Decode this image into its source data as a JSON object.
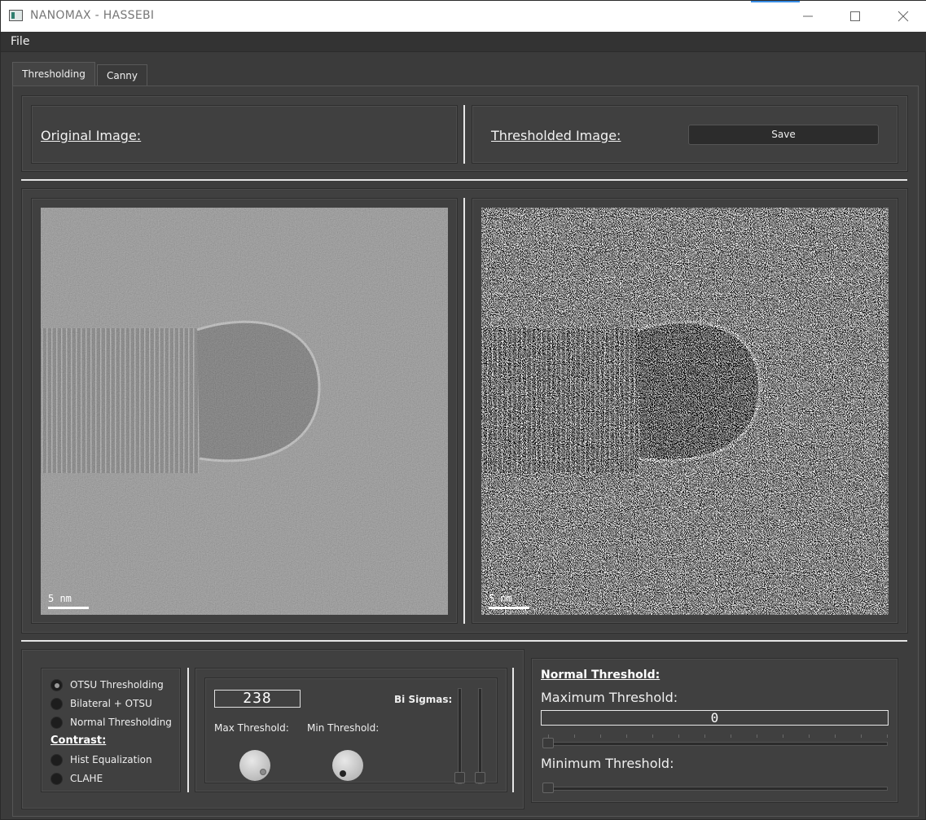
{
  "window": {
    "title": "NANOMAX - HASSEBI",
    "min_icon": "minimize-icon",
    "max_icon": "maximize-icon",
    "close_icon": "close-icon"
  },
  "menu": {
    "file": "File"
  },
  "tabs": [
    {
      "label": "Thresholding",
      "active": true
    },
    {
      "label": "Canny",
      "active": false
    }
  ],
  "header": {
    "original_label": "Original Image:",
    "thresholded_label": "Thresholded Image:",
    "save_label": "Save"
  },
  "images": {
    "scale_text": "5 nm"
  },
  "methods": {
    "options": [
      {
        "label": "OTSU Thresholding",
        "checked": true
      },
      {
        "label": "Bilateral + OTSU",
        "checked": false
      },
      {
        "label": "Normal Thresholding",
        "checked": false
      }
    ],
    "contrast_label": "Contrast:",
    "contrast_options": [
      {
        "label": "Hist Equalization",
        "checked": false
      },
      {
        "label": "CLAHE",
        "checked": false
      }
    ]
  },
  "dials": {
    "lcd_value": "238",
    "max_label": "Max Threshold:",
    "min_label": "Min Threshold:",
    "bi_sigmas_label": "Bi Sigmas:"
  },
  "normal_threshold": {
    "heading": "Normal Threshold:",
    "max_label": "Maximum Threshold:",
    "max_value": "0",
    "min_label": "Minimum Threshold:",
    "max_slider_fraction": 0,
    "min_slider_fraction": 0
  },
  "colors": {
    "background": "#3b3b3b",
    "accent": "#3a8ee6"
  }
}
